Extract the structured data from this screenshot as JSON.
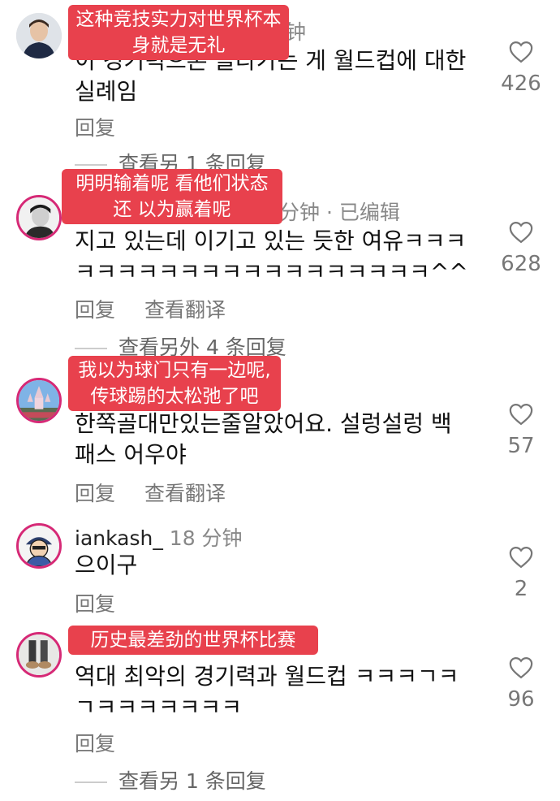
{
  "comments": [
    {
      "meta_visible": "钟",
      "text": "이 경기력으론 올라가는 게 월드컵에 대한\n실례임",
      "actions": [
        "回复"
      ],
      "likes": "426",
      "more_replies": "查看另 1 条回复",
      "subtitle": "这种竞技实力对世界杯本\n身就是无礼"
    },
    {
      "meta_visible": "分钟 · 已编辑",
      "text": "지고 있는데 이기고 있는 듯한 여유ㅋㅋㅋ\nㅋㅋㅋㅋㅋㅋㅋㅋㅋㅋㅋㅋㅋㅋㅋㅋㅋ^^",
      "actions": [
        "回复",
        "查看翻译"
      ],
      "likes": "628",
      "more_replies": "查看另外 4 条回复",
      "subtitle": "明明输着呢 看他们状态还\n以为赢着呢"
    },
    {
      "meta_visible": "",
      "text": "한쪽골대만있는줄알았어요. 설렁설렁 백\n패스 어우야",
      "actions": [
        "回复",
        "查看翻译"
      ],
      "likes": "57",
      "subtitle": "我以为球门只有一边呢,\n传球踢的太松弛了吧"
    },
    {
      "username": "iankash_",
      "time": "18 分钟",
      "text": "으이구",
      "actions": [
        "回复"
      ],
      "likes": "2"
    },
    {
      "meta_visible": "",
      "text": "역대 최악의 경기력과 월드컵 ㅋㅋㅋㄱㅋ\nㄱㅋㅋㅋㅋㅋㅋㅋ",
      "actions": [
        "回复"
      ],
      "likes": "96",
      "more_replies": "查看另 1 条回复",
      "subtitle": "历史最差劲的世界杯比赛"
    }
  ],
  "colors": {
    "subtitle_bg": "#e8414d",
    "story_ring": "#d62976"
  },
  "icons": {
    "like": "heart-outline-icon"
  }
}
